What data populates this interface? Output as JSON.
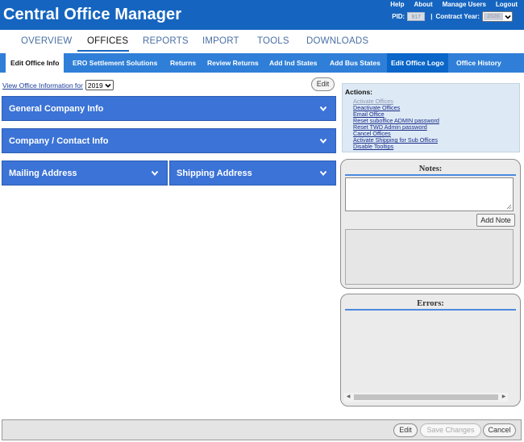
{
  "header": {
    "title": "Central Office Manager",
    "links": [
      "Help",
      "About",
      "Manage Users",
      "Logout"
    ],
    "pid_label": "PID:",
    "pid_value": "917",
    "contract_label": "Contract Year:",
    "contract_value": "2026"
  },
  "main_nav": {
    "tabs": [
      "OVERVIEW",
      "OFFICES",
      "REPORTS",
      "IMPORT",
      "TOOLS",
      "DOWNLOADS"
    ],
    "active": "OFFICES"
  },
  "sub_nav": {
    "tabs": [
      "Edit Office Info",
      "ERO Settlement Solutions",
      "Returns",
      "Review Returns",
      "Add Ind States",
      "Add Bus States",
      "Edit Office Logo",
      "Office History"
    ],
    "active": "Edit Office Info"
  },
  "view": {
    "label": "View Office Information for",
    "year": "2019",
    "edit_label": "Edit"
  },
  "sections": {
    "general": "General Company Info",
    "contact": "Company / Contact Info",
    "mailing": "Mailing Address",
    "shipping": "Shipping Address"
  },
  "actions": {
    "title": "Actions:",
    "items": [
      "Activate Offices",
      "Deactivate Offices",
      "Email Office",
      "Reset suboffice ADMIN password",
      "Reset TWD Admin password",
      "Cancel Offices",
      "Activate Shipping for Sub Offices",
      "Disable Tooltips"
    ]
  },
  "notes": {
    "title": "Notes:",
    "textarea_value": "",
    "add_label": "Add Note"
  },
  "errors": {
    "title": "Errors:"
  },
  "footer": {
    "edit_label": "Edit",
    "save_label": "Save Changes",
    "cancel_label": "Cancel"
  },
  "colors": {
    "header_bg": "#1565c0",
    "subnav_bg": "#2f7fd8",
    "section_bar": "#3b73d6",
    "actions_bg": "#dde9f5",
    "card_bg": "#ebebeb"
  },
  "icons": {
    "dropdown": "chevron-down-icon",
    "resize": "resize-grip-icon",
    "scroll_left": "scroll-left-arrow-icon",
    "scroll_right": "scroll-right-arrow-icon"
  }
}
